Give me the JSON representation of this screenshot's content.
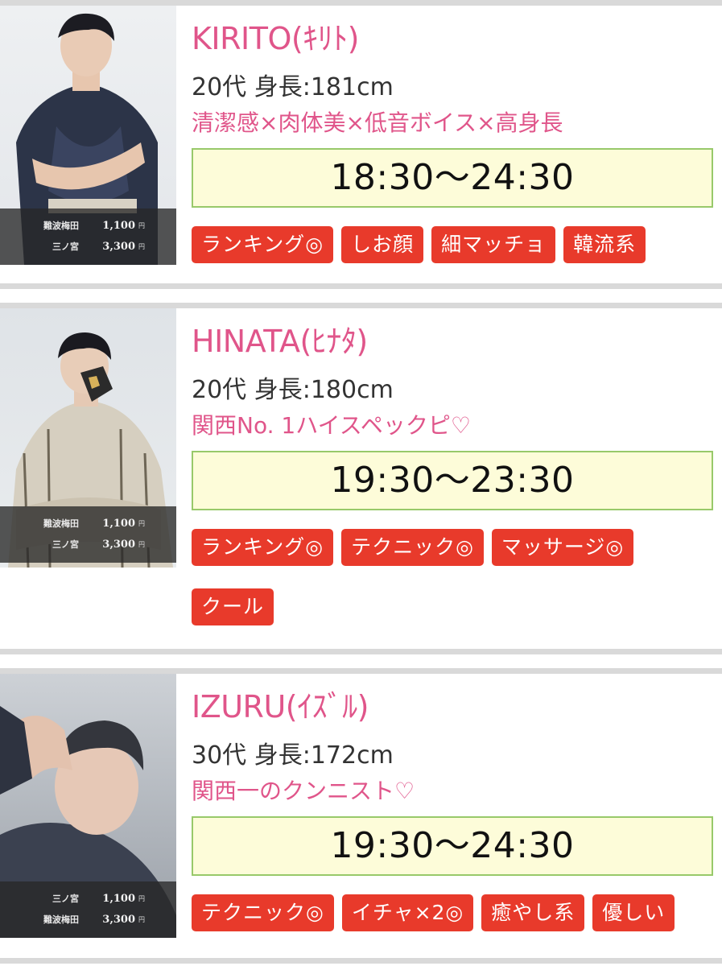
{
  "colors": {
    "accent_pink": "#e0558a",
    "tag_red": "#e83a2b",
    "time_bg": "#fdfcd9",
    "time_border": "#98c96a",
    "separator": "#d9d9d9"
  },
  "casts": [
    {
      "name": "KIRITO(ｷﾘﾄ)",
      "meta": "20代 身長:181cm",
      "catch": "清潔感×肉体美×低音ボイス×高身長",
      "time": "18:30〜24:30",
      "prices": [
        {
          "area": "難波梅田",
          "amount": "1,100",
          "unit": "円"
        },
        {
          "area": "三ノ宮",
          "amount": "3,300",
          "unit": "円"
        }
      ],
      "tags": [
        "ランキング◎",
        "しお顔",
        "細マッチョ",
        "韓流系"
      ]
    },
    {
      "name": "HINATA(ﾋﾅﾀ)",
      "meta": "20代 身長:180cm",
      "catch": "関西No. 1ハイスペックピ♡",
      "time": "19:30〜23:30",
      "prices": [
        {
          "area": "難波梅田",
          "amount": "1,100",
          "unit": "円"
        },
        {
          "area": "三ノ宮",
          "amount": "3,300",
          "unit": "円"
        }
      ],
      "tags": [
        "ランキング◎",
        "テクニック◎",
        "マッサージ◎",
        "クール"
      ]
    },
    {
      "name": "IZURU(ｲｽﾞﾙ)",
      "meta": "30代 身長:172cm",
      "catch": "関西一のクンニスト♡",
      "time": "19:30〜24:30",
      "prices": [
        {
          "area": "三ノ宮",
          "amount": "1,100",
          "unit": "円"
        },
        {
          "area": "難波梅田",
          "amount": "3,300",
          "unit": "円"
        }
      ],
      "tags": [
        "テクニック◎",
        "イチャ×2◎",
        "癒やし系",
        "優しい"
      ]
    }
  ]
}
